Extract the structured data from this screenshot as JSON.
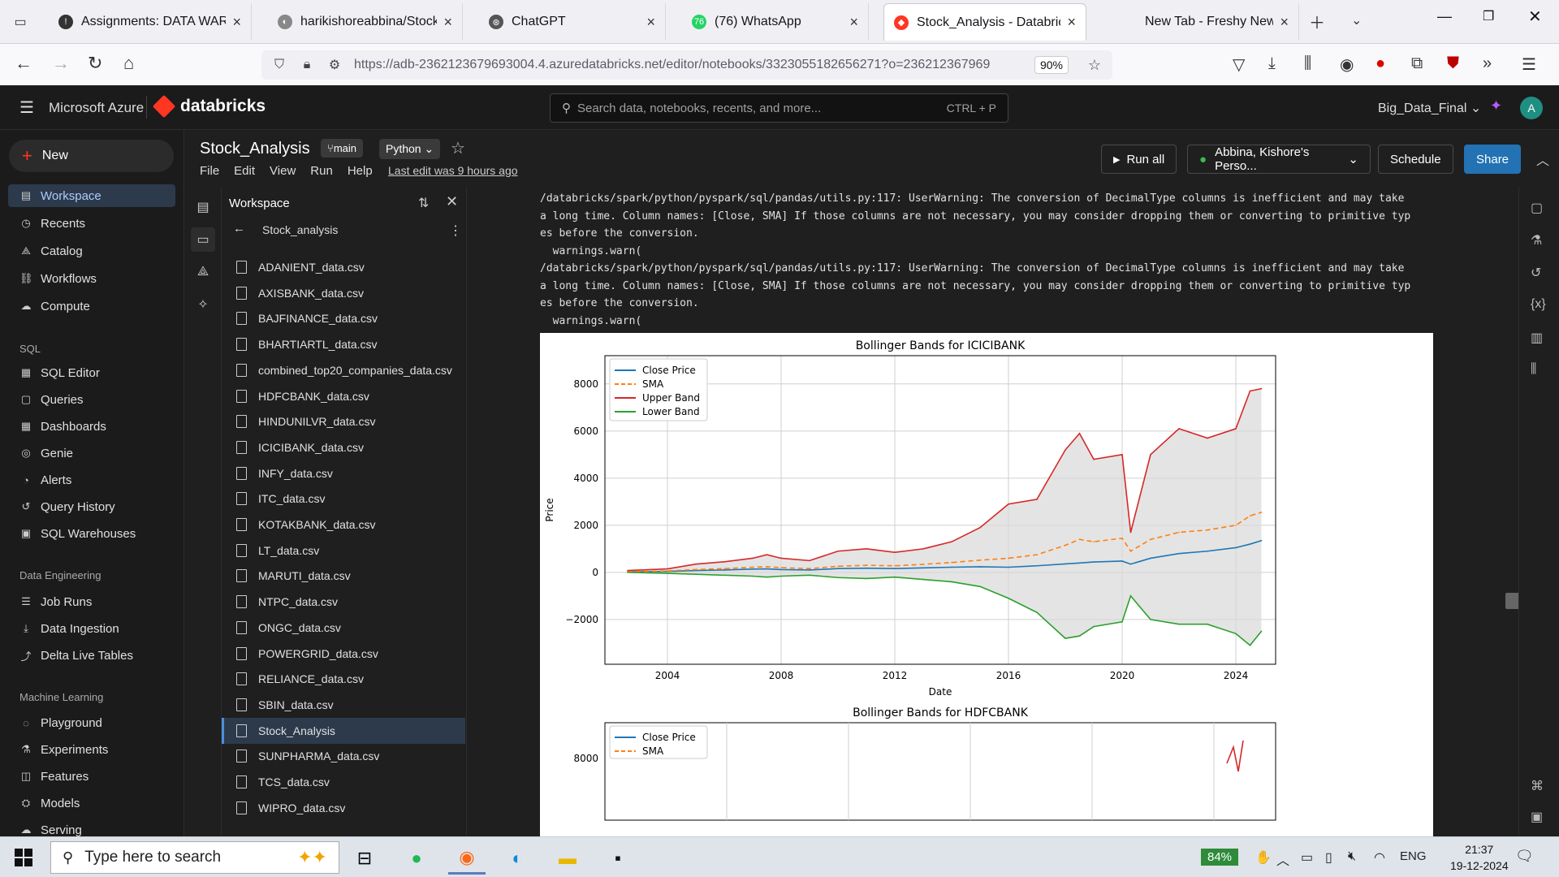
{
  "browser": {
    "tabs": [
      {
        "title": "Assignments: DATA WAREH",
        "fav": "!",
        "color": "#333"
      },
      {
        "title": "harikishoreabbina/Stock_an",
        "fav": "◐",
        "color": "#888"
      },
      {
        "title": "ChatGPT",
        "fav": "⊛",
        "color": "#555"
      },
      {
        "title": "(76) WhatsApp",
        "fav": "76",
        "color": "#25d366"
      },
      {
        "title": "Stock_Analysis - Databricks",
        "fav": "◆",
        "color": "#ff3621"
      },
      {
        "title": "New Tab - Freshy Newtab a",
        "fav": "",
        "color": "#f0f0f4"
      }
    ],
    "url": "https://adb-2362123679693004.4.azuredatabricks.net/editor/notebooks/3323055182656271?o=236212367969",
    "zoom": "90%"
  },
  "db": {
    "brand": "Microsoft Azure",
    "logo": "databricks",
    "search_placeholder": "Search data, notebooks, recents, and more...",
    "search_shortcut": "CTRL + P",
    "workspace_name": "Big_Data_Final",
    "avatar": "A"
  },
  "sidebar": {
    "new_label": "New",
    "items_top": [
      "Workspace",
      "Recents",
      "Catalog",
      "Workflows",
      "Compute"
    ],
    "sql_header": "SQL",
    "sql_items": [
      "SQL Editor",
      "Queries",
      "Dashboards",
      "Genie",
      "Alerts",
      "Query History",
      "SQL Warehouses"
    ],
    "de_header": "Data Engineering",
    "de_items": [
      "Job Runs",
      "Data Ingestion",
      "Delta Live Tables"
    ],
    "ml_header": "Machine Learning",
    "ml_items": [
      "Playground",
      "Experiments",
      "Features",
      "Models",
      "Serving"
    ]
  },
  "notebook": {
    "title": "Stock_Analysis",
    "branch": "main",
    "language": "Python",
    "menu": [
      "File",
      "Edit",
      "View",
      "Run",
      "Help"
    ],
    "last_edit": "Last edit was 9 hours ago",
    "run_all": "Run all",
    "cluster": "Abbina, Kishore's Perso...",
    "schedule": "Schedule",
    "share": "Share"
  },
  "workspace_panel": {
    "title": "Workspace",
    "path": "Stock_analysis",
    "files": [
      "ADANIENT_data.csv",
      "AXISBANK_data.csv",
      "BAJFINANCE_data.csv",
      "BHARTIARTL_data.csv",
      "combined_top20_companies_data.csv",
      "HDFCBANK_data.csv",
      "HINDUNILVR_data.csv",
      "ICICIBANK_data.csv",
      "INFY_data.csv",
      "ITC_data.csv",
      "KOTAKBANK_data.csv",
      "LT_data.csv",
      "MARUTI_data.csv",
      "NTPC_data.csv",
      "ONGC_data.csv",
      "POWERGRID_data.csv",
      "RELIANCE_data.csv",
      "SBIN_data.csv",
      "Stock_Analysis",
      "SUNPHARMA_data.csv",
      "TCS_data.csv",
      "WIPRO_data.csv"
    ],
    "active_index": 18
  },
  "output": {
    "log": "/databricks/spark/python/pyspark/sql/pandas/utils.py:117: UserWarning: The conversion of DecimalType columns is inefficient and may take a long time. Column names: [Close, SMA] If those columns are not necessary, you may consider dropping them or converting to primitive types before the conversion.\n  warnings.warn(\n/databricks/spark/python/pyspark/sql/pandas/utils.py:117: UserWarning: The conversion of DecimalType columns is inefficient and may take a long time. Column names: [Close, SMA] If those columns are not necessary, you may consider dropping them or converting to primitive types before the conversion.\n  warnings.warn("
  },
  "chart_data": [
    {
      "type": "line",
      "title": "Bollinger Bands for ICICIBANK",
      "xlabel": "Date",
      "ylabel": "Price",
      "xlim": [
        2001.8,
        2025.4
      ],
      "ylim": [
        -3900,
        9200
      ],
      "xticks": [
        "2004",
        "2008",
        "2012",
        "2016",
        "2020",
        "2024"
      ],
      "yticks": [
        "−2000",
        "0",
        "2000",
        "4000",
        "6000",
        "8000"
      ],
      "grid": true,
      "legend": "top-left",
      "x": [
        2002.6,
        2004,
        2005,
        2006,
        2007,
        2007.5,
        2008,
        2009,
        2010,
        2011,
        2012,
        2013,
        2014,
        2015,
        2016,
        2017,
        2018,
        2018.5,
        2019,
        2020,
        2020.3,
        2021,
        2022,
        2023,
        2024,
        2024.5,
        2024.9
      ],
      "series": [
        {
          "name": "Close Price",
          "color": "#1f77b4",
          "style": "solid",
          "values": [
            20,
            40,
            80,
            100,
            140,
            150,
            120,
            100,
            160,
            180,
            160,
            190,
            220,
            240,
            220,
            280,
            360,
            400,
            440,
            480,
            350,
            600,
            800,
            900,
            1050,
            1200,
            1350
          ]
        },
        {
          "name": "SMA",
          "color": "#ff7f0e",
          "style": "dashed",
          "values": [
            30,
            60,
            120,
            160,
            220,
            240,
            200,
            160,
            260,
            300,
            280,
            340,
            420,
            520,
            600,
            750,
            1150,
            1400,
            1300,
            1450,
            900,
            1400,
            1700,
            1800,
            2000,
            2400,
            2550
          ]
        },
        {
          "name": "Upper Band",
          "color": "#d62728",
          "style": "solid",
          "values": [
            80,
            150,
            350,
            450,
            600,
            750,
            600,
            500,
            900,
            1000,
            850,
            1000,
            1300,
            1900,
            2900,
            3100,
            5200,
            5900,
            4800,
            5000,
            1700,
            5000,
            6100,
            5700,
            6100,
            7700,
            7800
          ]
        },
        {
          "name": "Lower Band",
          "color": "#2ca02c",
          "style": "solid",
          "values": [
            0,
            -40,
            -80,
            -120,
            -160,
            -200,
            -160,
            -120,
            -220,
            -260,
            -200,
            -300,
            -400,
            -600,
            -1100,
            -1700,
            -2800,
            -2700,
            -2300,
            -2100,
            -1000,
            -2000,
            -2200,
            -2200,
            -2600,
            -3100,
            -2500
          ]
        }
      ]
    },
    {
      "type": "line",
      "title": "Bollinger Bands for HDFCBANK",
      "legend_items": [
        "Close Price",
        "SMA"
      ],
      "yticks": [
        "8000"
      ]
    }
  ],
  "taskbar": {
    "search_placeholder": "Type here to search",
    "battery": "84%",
    "lang": "ENG",
    "time": "21:37",
    "date": "19-12-2024"
  }
}
